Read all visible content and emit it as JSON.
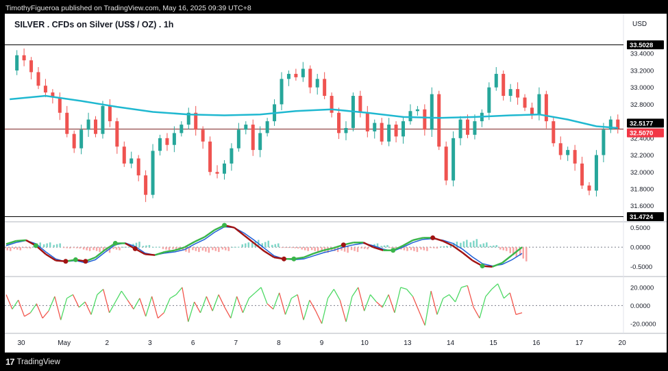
{
  "header": {
    "publisher_line": "TimothyFigueroa published on TradingView.com, May 16, 2025 09:39 UTC+8"
  },
  "footer": {
    "brand": "TradingView",
    "logo_glyph": "17"
  },
  "chart_data": {
    "type": "candlestick",
    "title": "SILVER . CFDs on Silver (US$ / OZ) . 1h",
    "currency": "USD",
    "colors": {
      "up": "#26a69a",
      "down": "#ef5350",
      "ma": "#1fb8d0",
      "macd_fast": "#1f5fd6",
      "macd_slow_up": "#3ab54a",
      "macd_slow_down": "#a11313",
      "rsi_up": "#4cd964",
      "rsi_down": "#f2554c"
    },
    "price_pane": {
      "ylim": [
        31.46,
        33.58
      ],
      "ticks": [
        "33.4000",
        "33.2000",
        "33.0000",
        "32.8000",
        "32.6000",
        "32.4000",
        "32.2000",
        "32.0000",
        "31.8000",
        "31.6000"
      ],
      "high_label": "33.5028",
      "low_label": "31.4724",
      "ma_label": "32.5177",
      "last_label": "32.5070",
      "high_value": 33.5028,
      "low_value": 31.4724,
      "ma_value": 32.5177,
      "last_value": 32.507,
      "close_path": [
        [
          0,
          33.2
        ],
        [
          1,
          33.38
        ],
        [
          2,
          33.32
        ],
        [
          3,
          33.18
        ],
        [
          4,
          33.02
        ],
        [
          5,
          32.94
        ],
        [
          6,
          32.88
        ],
        [
          7,
          32.7
        ],
        [
          8,
          32.45
        ],
        [
          9,
          32.28
        ],
        [
          10,
          32.5
        ],
        [
          11,
          32.62
        ],
        [
          12,
          32.45
        ],
        [
          13,
          32.78
        ],
        [
          14,
          32.6
        ],
        [
          15,
          32.3
        ],
        [
          16,
          32.1
        ],
        [
          17,
          32.16
        ],
        [
          18,
          31.96
        ],
        [
          19,
          31.73
        ],
        [
          20,
          32.25
        ],
        [
          21,
          32.4
        ],
        [
          22,
          32.32
        ],
        [
          23,
          32.46
        ],
        [
          24,
          32.56
        ],
        [
          25,
          32.7
        ],
        [
          26,
          32.5
        ],
        [
          27,
          32.36
        ],
        [
          28,
          32.0
        ],
        [
          29,
          31.98
        ],
        [
          30,
          32.1
        ],
        [
          31,
          32.28
        ],
        [
          32,
          32.5
        ],
        [
          33,
          32.56
        ],
        [
          34,
          32.26
        ],
        [
          35,
          32.46
        ],
        [
          36,
          32.6
        ],
        [
          37,
          32.8
        ],
        [
          38,
          33.1
        ],
        [
          39,
          33.16
        ],
        [
          40,
          33.12
        ],
        [
          41,
          33.22
        ],
        [
          42,
          33.0
        ],
        [
          43,
          33.1
        ],
        [
          44,
          32.9
        ],
        [
          45,
          32.7
        ],
        [
          46,
          32.46
        ],
        [
          47,
          32.52
        ],
        [
          48,
          32.9
        ],
        [
          49,
          32.7
        ],
        [
          50,
          32.48
        ],
        [
          51,
          32.58
        ],
        [
          52,
          32.36
        ],
        [
          53,
          32.56
        ],
        [
          54,
          32.42
        ],
        [
          55,
          32.6
        ],
        [
          56,
          32.72
        ],
        [
          57,
          32.74
        ],
        [
          58,
          32.5
        ],
        [
          59,
          32.92
        ],
        [
          60,
          32.3
        ],
        [
          61,
          31.9
        ],
        [
          62,
          32.4
        ],
        [
          63,
          32.62
        ],
        [
          64,
          32.44
        ],
        [
          65,
          32.6
        ],
        [
          66,
          32.7
        ],
        [
          67,
          33.0
        ],
        [
          68,
          33.16
        ],
        [
          69,
          32.9
        ],
        [
          70,
          32.98
        ],
        [
          71,
          32.88
        ],
        [
          72,
          32.76
        ],
        [
          73,
          32.68
        ],
        [
          74,
          32.92
        ],
        [
          75,
          32.6
        ],
        [
          76,
          32.34
        ],
        [
          77,
          32.2
        ],
        [
          78,
          32.26
        ],
        [
          79,
          32.1
        ],
        [
          80,
          31.84
        ],
        [
          81,
          31.78
        ],
        [
          82,
          32.2
        ],
        [
          83,
          32.5
        ],
        [
          84,
          32.62
        ],
        [
          85,
          32.51
        ]
      ],
      "ma_path": [
        [
          0,
          32.86
        ],
        [
          5,
          32.9
        ],
        [
          10,
          32.84
        ],
        [
          15,
          32.77
        ],
        [
          20,
          32.71
        ],
        [
          25,
          32.68
        ],
        [
          30,
          32.67
        ],
        [
          35,
          32.68
        ],
        [
          40,
          32.72
        ],
        [
          45,
          32.74
        ],
        [
          50,
          32.7
        ],
        [
          55,
          32.65
        ],
        [
          60,
          32.64
        ],
        [
          65,
          32.65
        ],
        [
          70,
          32.67
        ],
        [
          74,
          32.68
        ],
        [
          78,
          32.62
        ],
        [
          82,
          32.54
        ],
        [
          85,
          32.52
        ]
      ]
    },
    "macd_pane": {
      "ylim": [
        -0.68,
        0.58
      ],
      "ticks": [
        "0.5000",
        "0.0000",
        "-0.5000"
      ],
      "fast": [
        0.04,
        0.12,
        0.17,
        0.09,
        -0.12,
        -0.3,
        -0.37,
        -0.34,
        -0.4,
        -0.32,
        -0.12,
        0.06,
        0.11,
        0.02,
        -0.15,
        -0.2,
        -0.15,
        -0.12,
        -0.06,
        0.08,
        0.2,
        0.38,
        0.52,
        0.5,
        0.36,
        0.18,
        -0.02,
        -0.22,
        -0.3,
        -0.32,
        -0.3,
        -0.22,
        -0.14,
        -0.08,
        0.0,
        0.06,
        0.1,
        0.04,
        -0.05,
        -0.1,
        0.0,
        0.12,
        0.2,
        0.22,
        0.18,
        0.1,
        -0.05,
        -0.25,
        -0.42,
        -0.48,
        -0.44,
        -0.32,
        -0.16
      ],
      "slow": [
        0.08,
        0.16,
        0.18,
        0.04,
        -0.18,
        -0.34,
        -0.36,
        -0.32,
        -0.36,
        -0.26,
        -0.06,
        0.1,
        0.1,
        -0.04,
        -0.18,
        -0.2,
        -0.12,
        -0.08,
        0.0,
        0.14,
        0.26,
        0.44,
        0.56,
        0.5,
        0.3,
        0.1,
        -0.1,
        -0.26,
        -0.3,
        -0.3,
        -0.26,
        -0.16,
        -0.08,
        -0.02,
        0.06,
        0.12,
        0.12,
        0.0,
        -0.08,
        -0.08,
        0.04,
        0.18,
        0.24,
        0.24,
        0.16,
        0.04,
        -0.14,
        -0.34,
        -0.48,
        -0.5,
        -0.4,
        -0.2,
        0.0
      ],
      "cross_points": [
        3,
        6,
        7,
        8,
        11,
        13,
        22,
        28,
        29,
        34,
        39,
        43,
        48
      ]
    },
    "rsi_pane": {
      "ylim": [
        -27,
        29
      ],
      "ticks": [
        "20.0000",
        "0.0000",
        "-20.0000"
      ],
      "values": [
        12,
        -4,
        6,
        -12,
        -8,
        2,
        -14,
        -6,
        10,
        -16,
        8,
        12,
        -2,
        4,
        -10,
        12,
        18,
        -8,
        4,
        16,
        6,
        -4,
        8,
        -12,
        10,
        -14,
        -8,
        8,
        12,
        20,
        -18,
        4,
        -8,
        10,
        -6,
        12,
        -2,
        -14,
        10,
        -8,
        8,
        14,
        20,
        2,
        -4,
        14,
        -10,
        8,
        12,
        -16,
        6,
        -6,
        -20,
        8,
        18,
        6,
        -18,
        10,
        20,
        -6,
        12,
        4,
        -2,
        12,
        -8,
        20,
        18,
        10,
        -6,
        -22,
        16,
        -10,
        8,
        12,
        4,
        20,
        22,
        -2,
        -14,
        10,
        18,
        24,
        8,
        14,
        -10,
        -8
      ]
    },
    "x_axis": {
      "labels": [
        "30",
        "May",
        "2",
        "3",
        "6",
        "7",
        "8",
        "9",
        "10",
        "13",
        "14",
        "15",
        "16",
        "17",
        "20"
      ],
      "label_ticks": [
        0,
        6,
        12,
        18,
        24,
        30,
        36,
        42,
        48,
        54,
        60,
        66,
        72,
        78,
        84
      ],
      "label_domain": [
        0,
        86
      ]
    }
  }
}
